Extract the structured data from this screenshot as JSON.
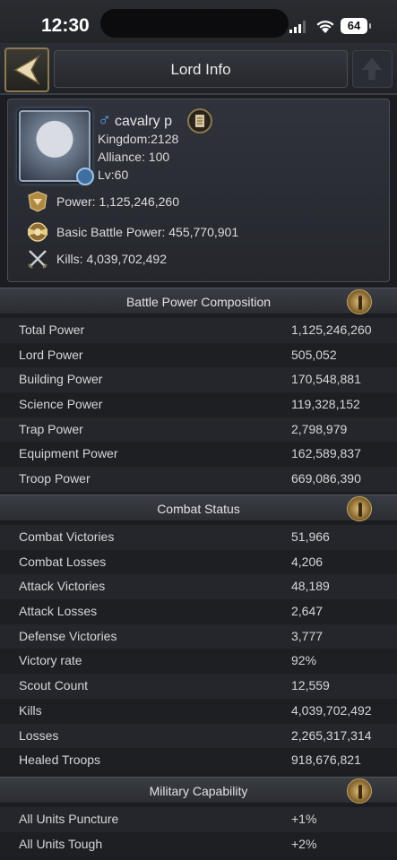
{
  "status_bar": {
    "time": "12:30",
    "battery": "64"
  },
  "header": {
    "title": "Lord Info"
  },
  "profile": {
    "name": "cavalry p",
    "kingdom": "Kingdom:2128",
    "alliance": "Alliance: 100",
    "level": "Lv:60",
    "power": "Power: 1,125,246,260",
    "basic_battle_power": "Basic Battle Power: 455,770,901",
    "kills": "Kills: 4,039,702,492"
  },
  "sections": {
    "battle_power": {
      "title": "Battle Power Composition",
      "rows": [
        {
          "label": "Total Power",
          "value": "1,125,246,260"
        },
        {
          "label": "Lord Power",
          "value": "505,052"
        },
        {
          "label": "Building Power",
          "value": "170,548,881"
        },
        {
          "label": "Science Power",
          "value": "119,328,152"
        },
        {
          "label": "Trap Power",
          "value": "2,798,979"
        },
        {
          "label": "Equipment Power",
          "value": "162,589,837"
        },
        {
          "label": "Troop Power",
          "value": "669,086,390"
        }
      ]
    },
    "combat_status": {
      "title": "Combat Status",
      "rows": [
        {
          "label": "Combat Victories",
          "value": "51,966"
        },
        {
          "label": "Combat Losses",
          "value": "4,206"
        },
        {
          "label": "Attack Victories",
          "value": "48,189"
        },
        {
          "label": "Attack Losses",
          "value": "2,647"
        },
        {
          "label": "Defense Victories",
          "value": "3,777"
        },
        {
          "label": "Victory rate",
          "value": "92%"
        },
        {
          "label": "Scout Count",
          "value": "12,559"
        },
        {
          "label": "Kills",
          "value": "4,039,702,492"
        },
        {
          "label": "Losses",
          "value": "2,265,317,314"
        },
        {
          "label": "Healed Troops",
          "value": "918,676,821"
        }
      ]
    },
    "military": {
      "title": "Military Capability",
      "rows": [
        {
          "label": "All Units Puncture",
          "value": "+1%"
        },
        {
          "label": "All Units Tough",
          "value": "+2%"
        }
      ]
    }
  }
}
